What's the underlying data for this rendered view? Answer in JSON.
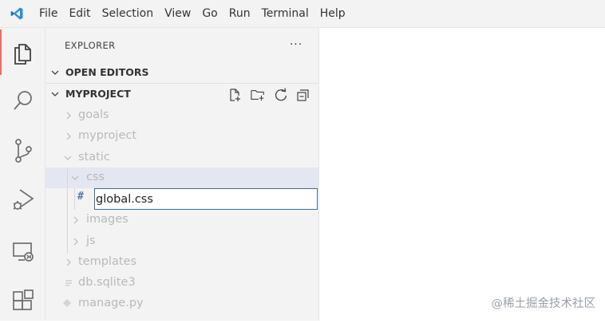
{
  "menubar": {
    "app_icon": "vscode-logo-icon",
    "items": [
      "File",
      "Edit",
      "Selection",
      "View",
      "Go",
      "Run",
      "Terminal",
      "Help"
    ]
  },
  "activity_bar": {
    "icons": [
      "explorer-files-icon",
      "search-icon",
      "source-control-icon",
      "run-debug-icon",
      "remote-explorer-icon",
      "extensions-icon"
    ],
    "active_accent": "#f26b5b"
  },
  "sidebar": {
    "title": "EXPLORER",
    "more_actions": "···",
    "open_editors": "OPEN EDITORS",
    "project": "MYPROJECT",
    "project_actions": [
      "new-file-icon",
      "new-folder-icon",
      "refresh-icon",
      "collapse-all-icon"
    ],
    "tree": {
      "goals": "goals",
      "myproject": "myproject",
      "static": "static",
      "css": "css",
      "images": "images",
      "js": "js",
      "templates": "templates",
      "db": "db.sqlite3",
      "manage": "manage.py"
    },
    "rename": {
      "icon": "#",
      "value": "global.css"
    }
  },
  "editor": {
    "watermark": "@稀土掘金技术社区"
  }
}
